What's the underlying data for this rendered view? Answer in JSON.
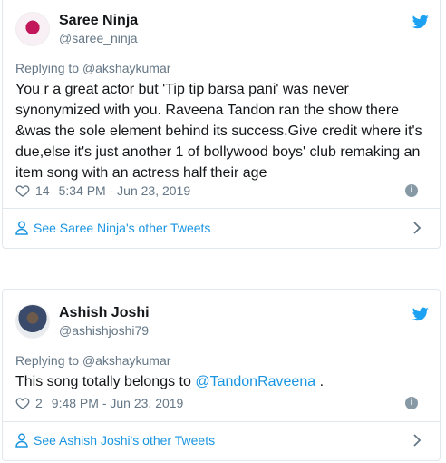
{
  "tweets": [
    {
      "name": "Saree Ninja",
      "handle": "@saree_ninja",
      "replying_prefix": "Replying to ",
      "replying_to": "@akshaykumar",
      "text": "You r a great actor but 'Tip tip barsa pani' was never synonymized with you. Raveena Tandon ran the show there &was the sole element behind its success.Give credit where it's due,else it's just another 1 of bollywood boys' club remaking an item song with an actress half their age",
      "likes": "14",
      "timestamp": "5:34 PM - Jun 23, 2019",
      "see_more": "See Saree Ninja's other Tweets"
    },
    {
      "name": "Ashish Joshi",
      "handle": "@ashishjoshi79",
      "replying_prefix": "Replying to ",
      "replying_to": "@akshaykumar",
      "text_before": "This song totally belongs to ",
      "text_mention": "@TandonRaveena",
      "text_after": " .",
      "likes": "2",
      "timestamp": "9:48 PM - Jun 23, 2019",
      "see_more": "See Ashish Joshi's other Tweets"
    }
  ],
  "colors": {
    "link": "#1b95e0",
    "muted": "#657786",
    "twitter_blue": "#1da1f2"
  },
  "icons": [
    "twitter-bird-icon",
    "heart-icon",
    "info-icon",
    "person-icon",
    "chevron-right-icon"
  ]
}
